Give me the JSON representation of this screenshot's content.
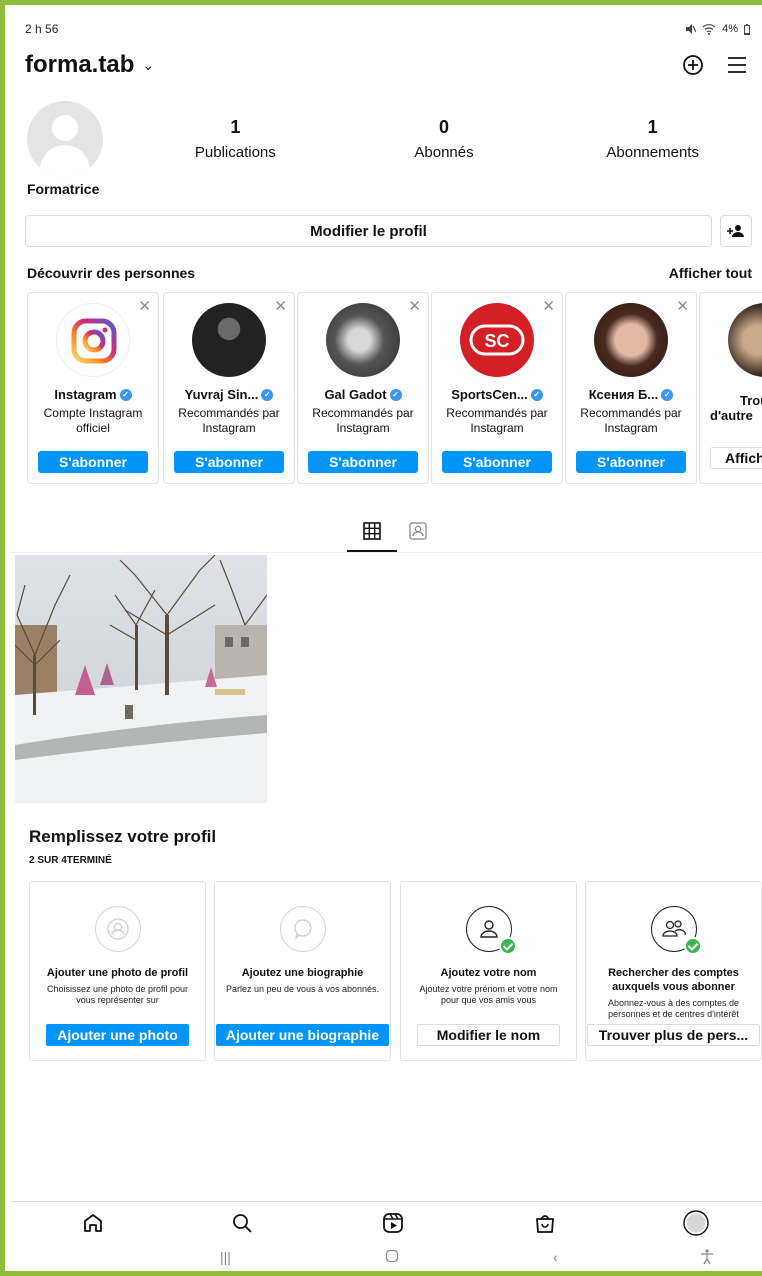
{
  "status_bar": {
    "time": "2 h 56",
    "battery": "4%"
  },
  "header": {
    "username": "forma.tab",
    "chevron": "⌄"
  },
  "profile": {
    "stats": [
      {
        "value": "1",
        "label": "Publications"
      },
      {
        "value": "0",
        "label": "Abonnés"
      },
      {
        "value": "1",
        "label": "Abonnements"
      }
    ],
    "display_name": "Formatrice",
    "edit_label": "Modifier le profil"
  },
  "discover": {
    "title": "Découvrir des personnes",
    "see_all": "Afficher tout",
    "cards": [
      {
        "name": "Instagram",
        "sub": "Compte Instagram officiel",
        "button": "S'abonner"
      },
      {
        "name": "Yuvraj Sin...",
        "sub": "Recommandés par Instagram",
        "button": "S'abonner"
      },
      {
        "name": "Gal Gadot",
        "sub": "Recommandés par Instagram",
        "button": "S'abonner"
      },
      {
        "name": "SportsCen...",
        "sub": "Recommandés par Instagram",
        "button": "S'abonner"
      },
      {
        "name": "Ксения Б...",
        "sub": "Recommandés par Instagram",
        "button": "S'abonner"
      }
    ],
    "more_card": {
      "title_line1": "Trou",
      "title_line2": "d'autre",
      "button": "Affiche"
    }
  },
  "complete_profile": {
    "title": "Remplissez votre profil",
    "progress": "2 SUR 4TERMINÉ",
    "tasks": [
      {
        "title": "Ajouter une photo de profil",
        "desc": "Choisissez une photo de profil pour vous représenter sur",
        "button": "Ajouter une photo"
      },
      {
        "title": "Ajoutez une biographie",
        "desc": "Parlez un peu de vous à vos abonnés.",
        "button": "Ajouter une biographie"
      },
      {
        "title": "Ajoutez votre nom",
        "desc": "Ajoutez votre prénom et votre nom pour que vos amis vous",
        "button": "Modifier le nom"
      },
      {
        "title": "Rechercher des comptes auxquels vous abonner",
        "desc": "Abonnez-vous à des comptes de personnes et de centres d'intérêt",
        "button": "Trouver plus de pers..."
      }
    ]
  },
  "icons": {
    "new_post": "plus-square-icon",
    "menu": "hamburger-menu-icon",
    "add_person": "add-person-icon",
    "grid": "grid-icon",
    "tagged": "tagged-icon",
    "home": "home-icon",
    "search": "search-icon",
    "reels": "reels-icon",
    "shop": "shop-icon",
    "profile": "profile-avatar-icon"
  },
  "colors": {
    "accent": "#0095f6",
    "frame": "#8dbb3c",
    "verified": "#3897f0",
    "check": "#3cb553"
  }
}
